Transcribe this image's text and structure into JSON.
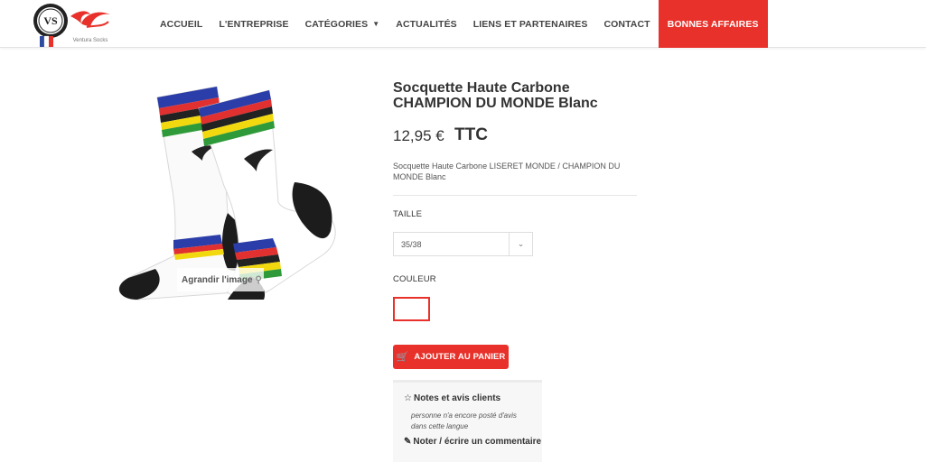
{
  "header": {
    "logo_caption": "Ventura Socks",
    "logo_badge": "VS",
    "nav": [
      {
        "label": "ACCUEIL"
      },
      {
        "label": "L'ENTREPRISE"
      },
      {
        "label": "CATÉGORIES"
      },
      {
        "label": "ACTUALITÉS"
      },
      {
        "label": "LIENS ET PARTENAIRES"
      },
      {
        "label": "CONTACT"
      },
      {
        "label": "BONNES AFFAIRES"
      }
    ],
    "accent_color": "#e8312a"
  },
  "product": {
    "title": "Socquette Haute Carbone CHAMPION DU MONDE Blanc",
    "price": "12,95 €",
    "tax_label": "TTC",
    "description": "Socquette Haute Carbone LISERET MONDE / CHAMPION DU MONDE Blanc",
    "zoom_label": "Agrandir l'image",
    "size_label": "TAILLE",
    "size_selected": "35/38",
    "color_label": "COULEUR",
    "add_to_cart_label": "AJOUTER AU PANIER"
  },
  "reviews": {
    "title": "Notes et avis clients",
    "empty_text": "personne n'a encore posté d'avis dans cette langue",
    "write_label": "Noter / écrire un commentaire"
  },
  "icons": {
    "caret": "caret-down-icon",
    "search": "search-icon",
    "chevron": "chevron-down-icon",
    "cart": "cart-icon",
    "star": "star-outline-icon",
    "pencil": "pencil-icon"
  }
}
